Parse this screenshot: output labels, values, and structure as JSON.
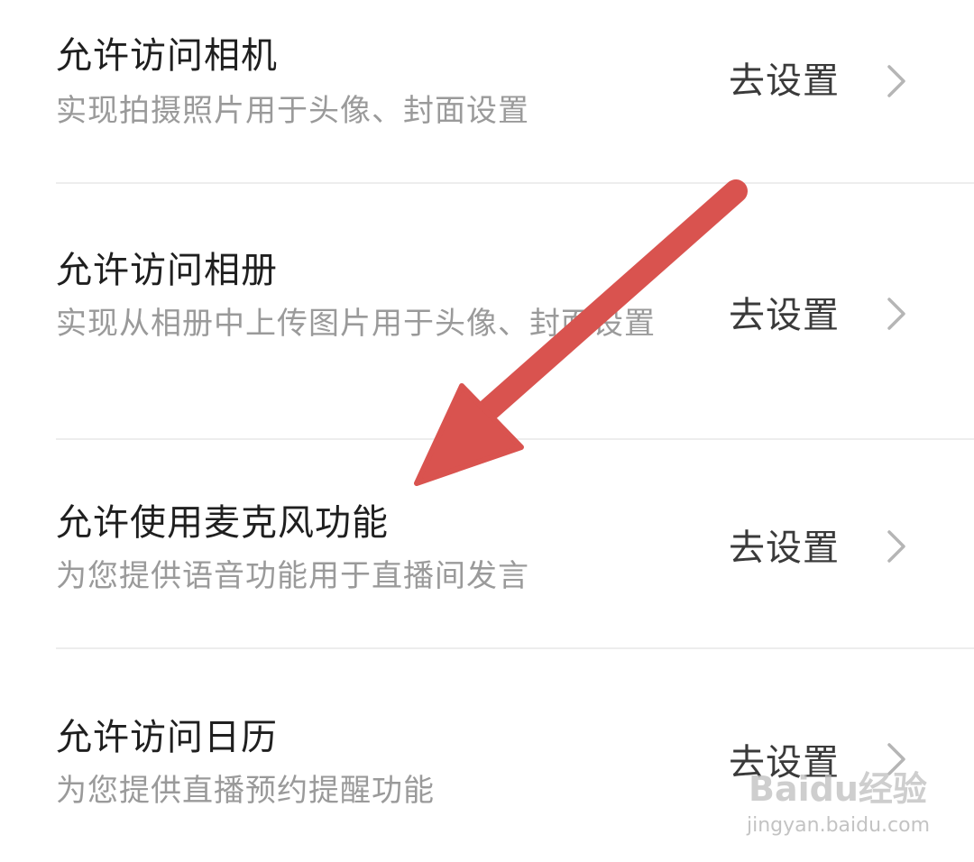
{
  "permissions": [
    {
      "title": "允许访问相机",
      "description": "实现拍摄照片用于头像、封面设置",
      "action": "去设置"
    },
    {
      "title": "允许访问相册",
      "description": "实现从相册中上传图片用于头像、封面设置",
      "action": "去设置"
    },
    {
      "title": "允许使用麦克风功能",
      "description": "为您提供语音功能用于直播间发言",
      "action": "去设置"
    },
    {
      "title": "允许访问日历",
      "description": "为您提供直播预约提醒功能",
      "action": "去设置"
    }
  ],
  "annotation": {
    "arrow_color": "#d9534f"
  },
  "watermark": {
    "main": "Baidu经验",
    "sub": "jingyan.baidu.com"
  },
  "icons": {
    "row_chevron": "chevron-right-icon"
  }
}
